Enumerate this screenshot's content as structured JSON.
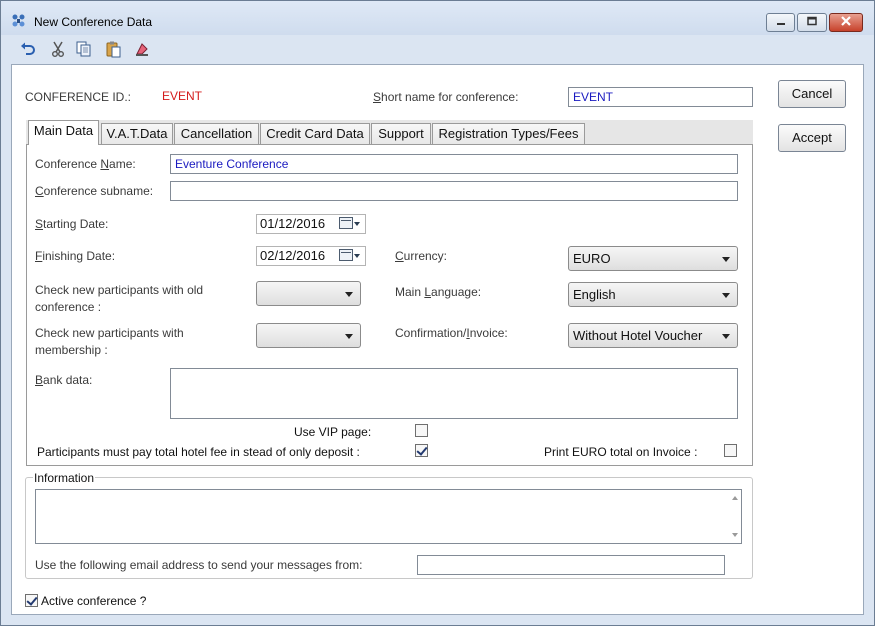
{
  "window": {
    "title": "New Conference Data",
    "icons": [
      "app-icon",
      "minimize-icon",
      "maximize-icon",
      "close-icon"
    ]
  },
  "toolbar": {
    "icons": [
      "undo-icon",
      "cut-icon",
      "copy-icon",
      "paste-icon",
      "clear-icon"
    ]
  },
  "header": {
    "conference_id_label": "CONFERENCE ID.:",
    "conference_id_value": "EVENT",
    "short_name_label": "Short name for conference:",
    "short_name_value": "EVENT"
  },
  "buttons": {
    "cancel": "Cancel",
    "accept": "Accept"
  },
  "tabs": [
    {
      "label": "Main Data",
      "active": true
    },
    {
      "label": "V.A.T.Data",
      "active": false
    },
    {
      "label": "Cancellation",
      "active": false
    },
    {
      "label": "Credit Card Data",
      "active": false
    },
    {
      "label": "Support",
      "active": false
    },
    {
      "label": "Registration Types/Fees",
      "active": false
    }
  ],
  "main": {
    "conference_name_label": "Conference Name:",
    "conference_name_value": "Eventure Conference",
    "conference_subname_label": "Conference subname:",
    "conference_subname_value": "",
    "starting_date_label": "Starting Date:",
    "starting_date_value": "01/12/2016",
    "finishing_date_label": "Finishing Date:",
    "finishing_date_value": "02/12/2016",
    "currency_label": "Currency:",
    "currency_value": "EURO",
    "check_old_label_1": "Check new participants with old",
    "check_old_label_2": "conference :",
    "check_old_value": "",
    "main_language_label": "Main Language:",
    "main_language_value": "English",
    "check_membership_label_1": "Check new participants with",
    "check_membership_label_2": "membership :",
    "check_membership_value": "",
    "confirmation_label": "Confirmation/Invoice:",
    "confirmation_value": "Without Hotel Voucher",
    "bank_data_label": "Bank data:",
    "bank_data_value": "",
    "use_vip_label": "Use VIP page:",
    "use_vip_checked": false,
    "pay_total_label": "Participants must pay total hotel fee in stead of only deposit :",
    "pay_total_checked": true,
    "print_euro_label": "Print EURO total on Invoice :",
    "print_euro_checked": false
  },
  "information": {
    "group_label": "Information",
    "memo_value": "",
    "email_label": "Use the following email address to send your messages from:",
    "email_value": ""
  },
  "footer": {
    "active_label": "Active conference ?",
    "active_checked": true
  },
  "colors": {
    "accent_text": "#1a1ac0",
    "id_red": "#d41b1b",
    "window_frame": "#dbe5f2"
  }
}
